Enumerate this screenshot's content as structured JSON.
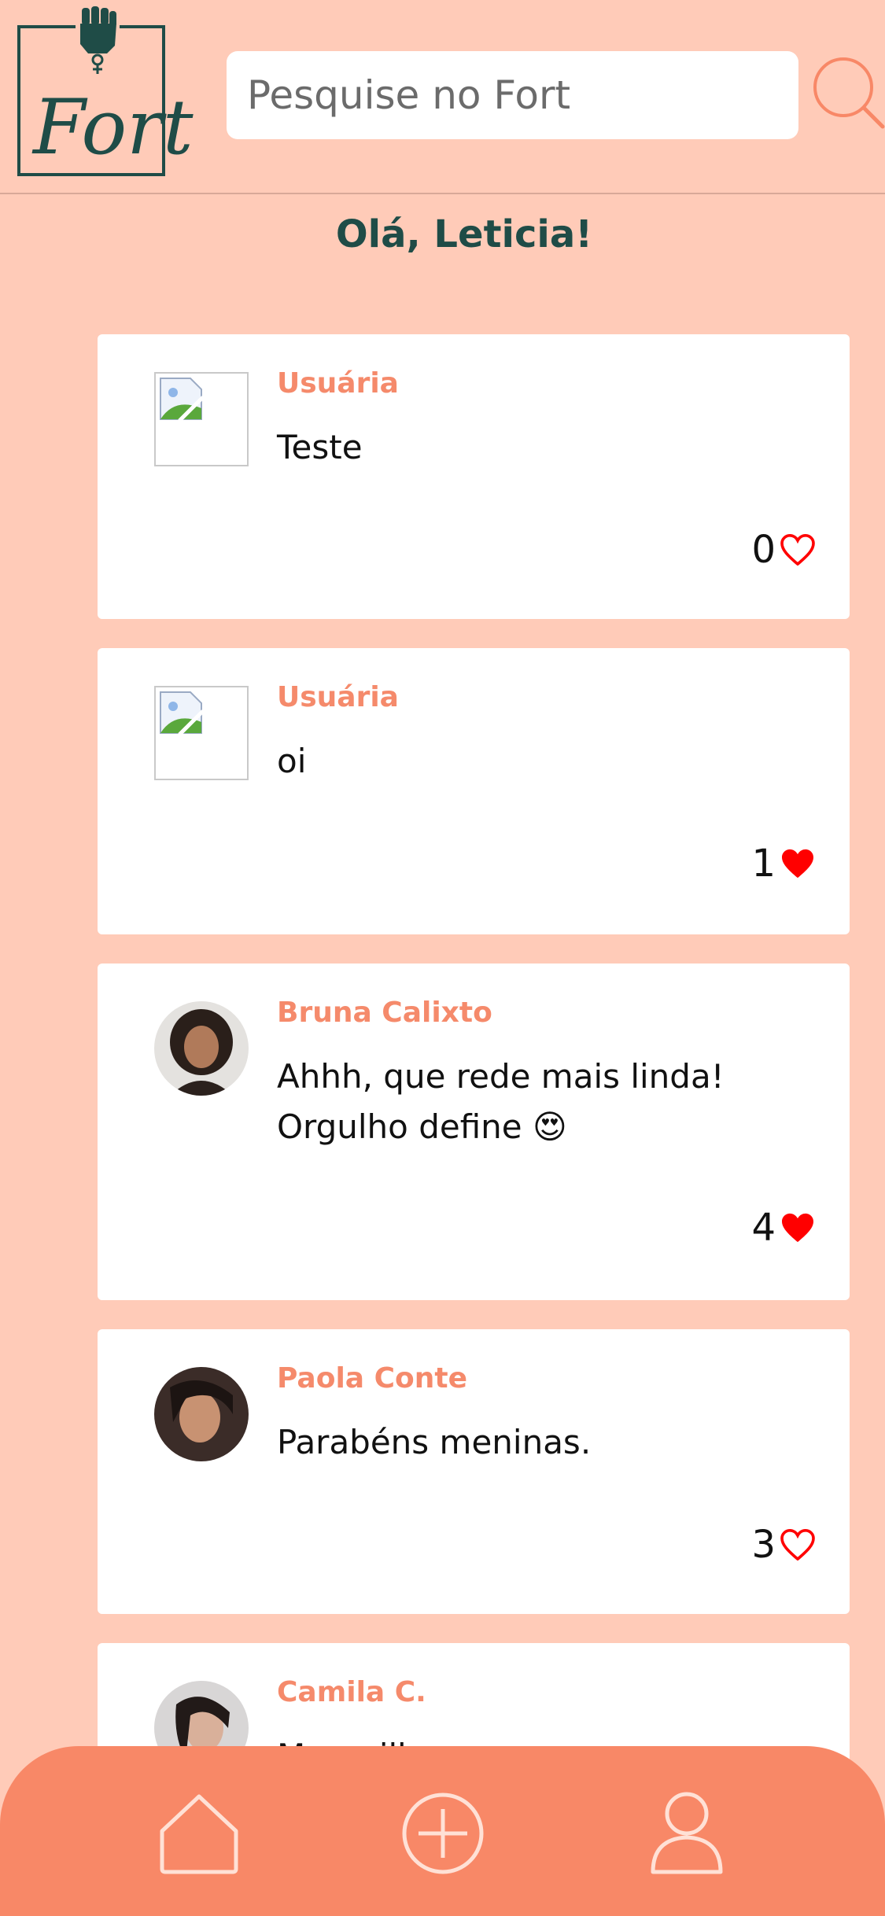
{
  "header": {
    "logo_text": "Fort",
    "search_placeholder": "Pesquise no Fort",
    "search_icon": "search-icon"
  },
  "greeting": "Olá, Leticia!",
  "posts": [
    {
      "author": "Usuária",
      "text": "Teste",
      "likes": "0",
      "liked": false,
      "avatar": "placeholder"
    },
    {
      "author": "Usuária",
      "text": "oi",
      "likes": "1",
      "liked": true,
      "avatar": "placeholder"
    },
    {
      "author": "Bruna Calixto",
      "text": "Ahhh, que rede mais linda! Orgulho define 😍",
      "likes": "4",
      "liked": true,
      "avatar": "photo"
    },
    {
      "author": "Paola Conte",
      "text": "Parabéns meninas.",
      "likes": "3",
      "liked": false,
      "avatar": "photo"
    },
    {
      "author": "Camila C.",
      "text": "Maravilhaaaaa",
      "likes": "",
      "liked": false,
      "avatar": "photo"
    }
  ],
  "nav": {
    "items": [
      "home-icon",
      "add-post-icon",
      "profile-icon"
    ]
  },
  "colors": {
    "background": "#ffcbb8",
    "accent": "#f88867",
    "brand": "#1f4c47",
    "heart": "#ff0000"
  }
}
